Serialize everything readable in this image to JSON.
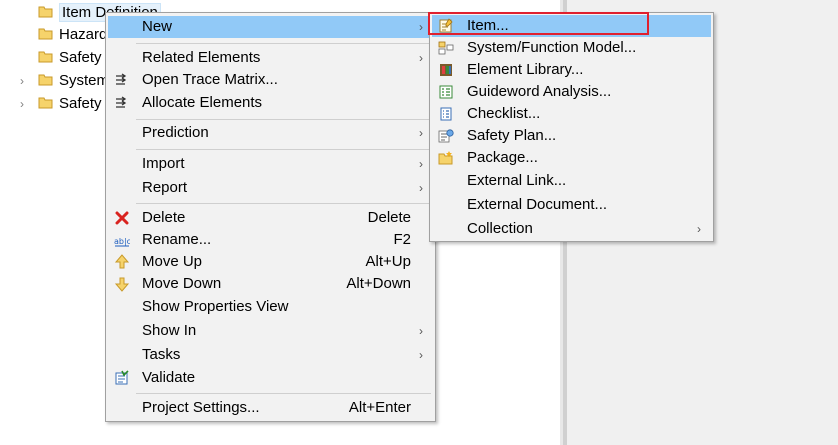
{
  "tree": {
    "items": [
      {
        "label": "Item Definition",
        "expandable": false,
        "selected": true
      },
      {
        "label": "Hazard",
        "expandable": false,
        "selected": false
      },
      {
        "label": "Safety",
        "expandable": false,
        "selected": false
      },
      {
        "label": "System",
        "expandable": true,
        "selected": false
      },
      {
        "label": "Safety",
        "expandable": true,
        "selected": false
      }
    ]
  },
  "context_menu": {
    "items": [
      {
        "label": "New",
        "shortcut": "",
        "submenu": true,
        "icon": ""
      },
      {
        "label": "Related Elements",
        "shortcut": "",
        "submenu": true,
        "icon": ""
      },
      {
        "label": "Open Trace Matrix...",
        "shortcut": "",
        "submenu": false,
        "icon": "trace-matrix-icon"
      },
      {
        "label": "Allocate Elements",
        "shortcut": "",
        "submenu": false,
        "icon": "allocate-icon"
      },
      {
        "label": "Prediction",
        "shortcut": "",
        "submenu": true,
        "icon": ""
      },
      {
        "label": "Import",
        "shortcut": "",
        "submenu": true,
        "icon": ""
      },
      {
        "label": "Report",
        "shortcut": "",
        "submenu": true,
        "icon": ""
      },
      {
        "label": "Delete",
        "shortcut": "Delete",
        "submenu": false,
        "icon": "delete-icon"
      },
      {
        "label": "Rename...",
        "shortcut": "F2",
        "submenu": false,
        "icon": "rename-icon"
      },
      {
        "label": "Move Up",
        "shortcut": "Alt+Up",
        "submenu": false,
        "icon": "move-up-icon"
      },
      {
        "label": "Move Down",
        "shortcut": "Alt+Down",
        "submenu": false,
        "icon": "move-down-icon"
      },
      {
        "label": "Show Properties View",
        "shortcut": "",
        "submenu": false,
        "icon": ""
      },
      {
        "label": "Show In",
        "shortcut": "",
        "submenu": true,
        "icon": ""
      },
      {
        "label": "Tasks",
        "shortcut": "",
        "submenu": true,
        "icon": ""
      },
      {
        "label": "Validate",
        "shortcut": "",
        "submenu": false,
        "icon": "validate-icon"
      },
      {
        "label": "Project Settings...",
        "shortcut": "Alt+Enter",
        "submenu": false,
        "icon": ""
      }
    ]
  },
  "new_submenu": {
    "items": [
      {
        "label": "Item...",
        "submenu": false,
        "icon": "item-icon"
      },
      {
        "label": "System/Function Model...",
        "submenu": false,
        "icon": "system-model-icon"
      },
      {
        "label": "Element Library...",
        "submenu": false,
        "icon": "element-library-icon"
      },
      {
        "label": "Guideword Analysis...",
        "submenu": false,
        "icon": "guideword-icon"
      },
      {
        "label": "Checklist...",
        "submenu": false,
        "icon": "checklist-icon"
      },
      {
        "label": "Safety Plan...",
        "submenu": false,
        "icon": "safety-plan-icon"
      },
      {
        "label": "Package...",
        "submenu": false,
        "icon": "package-icon"
      },
      {
        "label": "External Link...",
        "submenu": false,
        "icon": ""
      },
      {
        "label": "External Document...",
        "submenu": false,
        "icon": ""
      },
      {
        "label": "Collection",
        "submenu": true,
        "icon": ""
      }
    ]
  },
  "colors": {
    "highlight": "#91c9f7",
    "focus_border": "#e0202e",
    "menu_bg": "#f2f2f2"
  }
}
